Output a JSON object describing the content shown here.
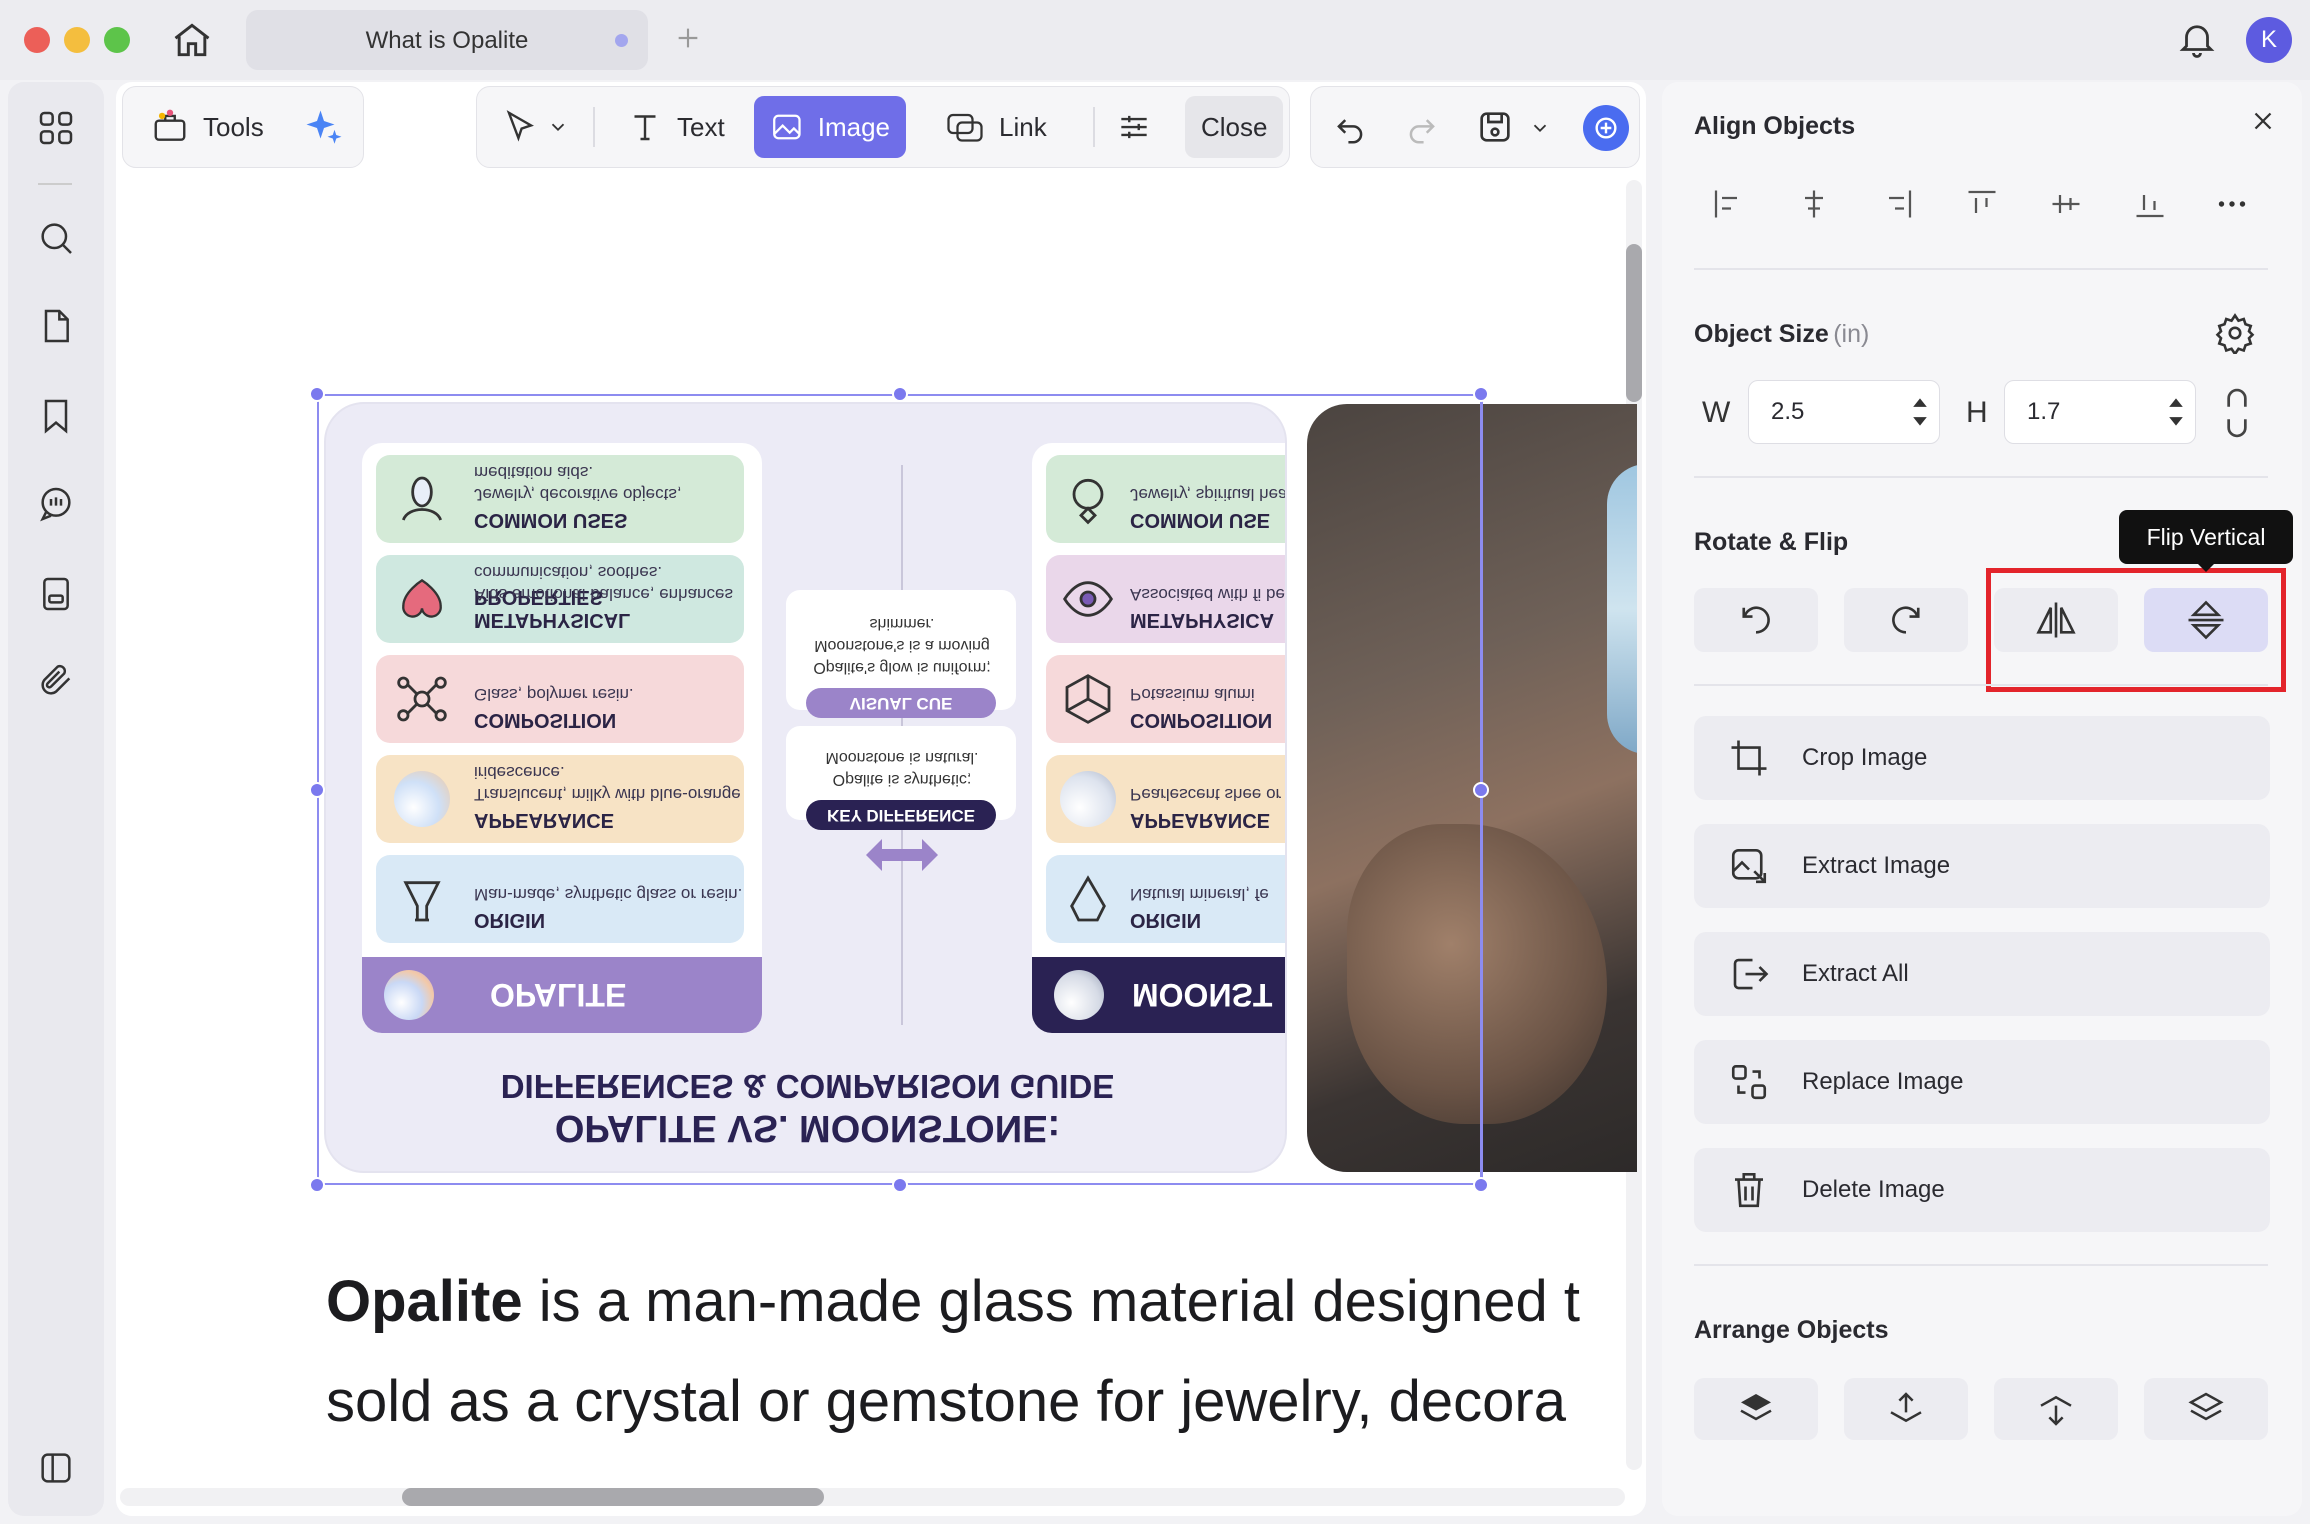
{
  "window": {
    "tab_title": "What is Opalite",
    "avatar_letter": "K"
  },
  "toolbar": {
    "tools_label": "Tools",
    "text_label": "Text",
    "image_label": "Image",
    "link_label": "Link",
    "close_label": "Close"
  },
  "infographic": {
    "title_line1": "OPALITE VS. MOONSTONE:",
    "title_line2": "DIFFERENCES & COMPARISON GUIDE",
    "opalite_header": "OPALITE",
    "moonstone_header": "MOONST",
    "opalite_rows": [
      {
        "title": "ORIGIN",
        "text": "Man-made, synthetic glass or resin."
      },
      {
        "title": "APPEARANCE",
        "text": "Translucent, milky with blue-orange iridescence."
      },
      {
        "title": "COMPOSITION",
        "text": "Glass, polymer resin."
      },
      {
        "title": "METAPHYSICAL PROPERTIES",
        "text": "Aids emotional balance, enhances communication, soothes."
      },
      {
        "title": "COMMON USES",
        "text": "Jewelry, decorative objects, meditation aids."
      }
    ],
    "moonstone_rows": [
      {
        "title": "ORIGIN",
        "text": "Natural mineral, fe"
      },
      {
        "title": "APPEARANCE",
        "text": "Pearlescent shee or adularescent."
      },
      {
        "title": "COMPOSITION",
        "text": "Potassium alumi"
      },
      {
        "title": "METAPHYSICA",
        "text": "Associated with fi beginnings, femi"
      },
      {
        "title": "COMMON USE",
        "text": "Jewelry, spiritual healing tools."
      }
    ],
    "key_difference_label": "KEY DIFFERENCE",
    "key_difference_text": "Opalite is synthetic; Moonstone is natural.",
    "visual_cue_label": "VISUAL CUE",
    "visual_cue_text": "Opalite's glow is uniform; Moonstone's is a moving shimmer."
  },
  "document": {
    "line1_bold": "Opalite",
    "line1_rest": " is a man-made glass material designed t",
    "line2": "sold as a crystal or gemstone for jewelry, decora"
  },
  "panel": {
    "align_title": "Align Objects",
    "size_title": "Object Size",
    "size_unit": "(in)",
    "w_label": "W",
    "w_value": "2.5",
    "h_label": "H",
    "h_value": "1.7",
    "rotate_title": "Rotate & Flip",
    "tooltip": "Flip Vertical",
    "actions": {
      "crop": "Crop Image",
      "extract": "Extract Image",
      "extract_all": "Extract All",
      "replace": "Replace Image",
      "delete": "Delete Image"
    },
    "arrange_title": "Arrange Objects"
  },
  "colors": {
    "accent": "#6f6ee8",
    "highlight_box": "#e3242b",
    "opalite_purple": "#9b84c9",
    "moonstone_navy": "#2a2253"
  }
}
